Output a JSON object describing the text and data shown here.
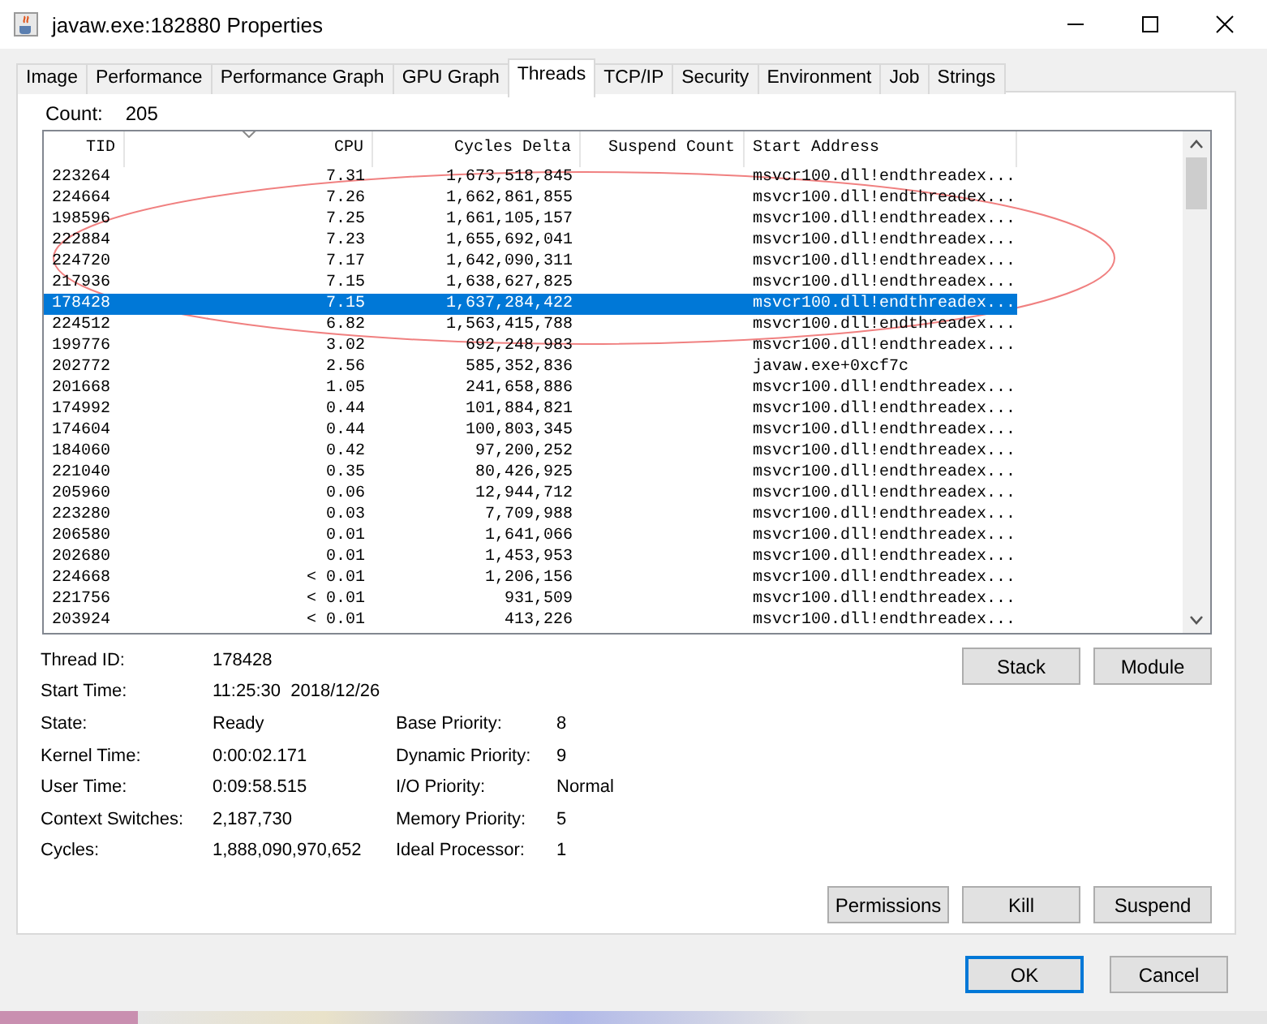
{
  "window": {
    "title": "javaw.exe:182880 Properties"
  },
  "tabs": [
    {
      "label": "Image",
      "selected": false
    },
    {
      "label": "Performance",
      "selected": false
    },
    {
      "label": "Performance Graph",
      "selected": false
    },
    {
      "label": "GPU Graph",
      "selected": false
    },
    {
      "label": "Threads",
      "selected": true
    },
    {
      "label": "TCP/IP",
      "selected": false
    },
    {
      "label": "Security",
      "selected": false
    },
    {
      "label": "Environment",
      "selected": false
    },
    {
      "label": "Job",
      "selected": false
    },
    {
      "label": "Strings",
      "selected": false
    }
  ],
  "count": {
    "label": "Count:",
    "value": "205"
  },
  "table": {
    "columns": [
      "TID",
      "CPU",
      "Cycles Delta",
      "Suspend Count",
      "Start Address"
    ],
    "rows": [
      {
        "tid": "223264",
        "cpu": "7.31",
        "cycles": "1,673,518,845",
        "address": "msvcr100.dll!endthreadex...",
        "selected": false
      },
      {
        "tid": "224664",
        "cpu": "7.26",
        "cycles": "1,662,861,855",
        "address": "msvcr100.dll!endthreadex...",
        "selected": false
      },
      {
        "tid": "198596",
        "cpu": "7.25",
        "cycles": "1,661,105,157",
        "address": "msvcr100.dll!endthreadex...",
        "selected": false
      },
      {
        "tid": "222884",
        "cpu": "7.23",
        "cycles": "1,655,692,041",
        "address": "msvcr100.dll!endthreadex...",
        "selected": false
      },
      {
        "tid": "224720",
        "cpu": "7.17",
        "cycles": "1,642,090,311",
        "address": "msvcr100.dll!endthreadex...",
        "selected": false
      },
      {
        "tid": "217936",
        "cpu": "7.15",
        "cycles": "1,638,627,825",
        "address": "msvcr100.dll!endthreadex...",
        "selected": false
      },
      {
        "tid": "178428",
        "cpu": "7.15",
        "cycles": "1,637,284,422",
        "address": "msvcr100.dll!endthreadex...",
        "selected": true
      },
      {
        "tid": "224512",
        "cpu": "6.82",
        "cycles": "1,563,415,788",
        "address": "msvcr100.dll!endthreadex...",
        "selected": false
      },
      {
        "tid": "199776",
        "cpu": "3.02",
        "cycles": "692,248,983",
        "address": "msvcr100.dll!endthreadex...",
        "selected": false
      },
      {
        "tid": "202772",
        "cpu": "2.56",
        "cycles": "585,352,836",
        "address": "javaw.exe+0xcf7c",
        "selected": false
      },
      {
        "tid": "201668",
        "cpu": "1.05",
        "cycles": "241,658,886",
        "address": "msvcr100.dll!endthreadex...",
        "selected": false
      },
      {
        "tid": "174992",
        "cpu": "0.44",
        "cycles": "101,884,821",
        "address": "msvcr100.dll!endthreadex...",
        "selected": false
      },
      {
        "tid": "174604",
        "cpu": "0.44",
        "cycles": "100,803,345",
        "address": "msvcr100.dll!endthreadex...",
        "selected": false
      },
      {
        "tid": "184060",
        "cpu": "0.42",
        "cycles": "97,200,252",
        "address": "msvcr100.dll!endthreadex...",
        "selected": false
      },
      {
        "tid": "221040",
        "cpu": "0.35",
        "cycles": "80,426,925",
        "address": "msvcr100.dll!endthreadex...",
        "selected": false
      },
      {
        "tid": "205960",
        "cpu": "0.06",
        "cycles": "12,944,712",
        "address": "msvcr100.dll!endthreadex...",
        "selected": false
      },
      {
        "tid": "223280",
        "cpu": "0.03",
        "cycles": "7,709,988",
        "address": "msvcr100.dll!endthreadex...",
        "selected": false
      },
      {
        "tid": "206580",
        "cpu": "0.01",
        "cycles": "1,641,066",
        "address": "msvcr100.dll!endthreadex...",
        "selected": false
      },
      {
        "tid": "202680",
        "cpu": "0.01",
        "cycles": "1,453,953",
        "address": "msvcr100.dll!endthreadex...",
        "selected": false
      },
      {
        "tid": "224668",
        "cpu": "< 0.01",
        "cycles": "1,206,156",
        "address": "msvcr100.dll!endthreadex...",
        "selected": false
      },
      {
        "tid": "221756",
        "cpu": "< 0.01",
        "cycles": "931,509",
        "address": "msvcr100.dll!endthreadex...",
        "selected": false
      },
      {
        "tid": "203924",
        "cpu": "< 0.01",
        "cycles": "413,226",
        "address": "msvcr100.dll!endthreadex...",
        "selected": false
      }
    ]
  },
  "details": {
    "top": [
      {
        "label": "Thread ID:",
        "value": "178428"
      },
      {
        "label": "Start Time:",
        "value": "11:25:30  2018/12/26"
      }
    ],
    "left": [
      {
        "label": "State:",
        "value": "Ready"
      },
      {
        "label": "Kernel Time:",
        "value": "0:00:02.171"
      },
      {
        "label": "User Time:",
        "value": "0:09:58.515"
      },
      {
        "label": "Context Switches:",
        "value": "2,187,730"
      },
      {
        "label": "Cycles:",
        "value": "1,888,090,970,652"
      }
    ],
    "right": [
      {
        "label": "Base Priority:",
        "value": "8"
      },
      {
        "label": "Dynamic Priority:",
        "value": "9"
      },
      {
        "label": "I/O Priority:",
        "value": "Normal"
      },
      {
        "label": "Memory Priority:",
        "value": "5"
      },
      {
        "label": "Ideal Processor:",
        "value": "1"
      }
    ]
  },
  "top_buttons": [
    "Stack",
    "Module"
  ],
  "bottom_buttons": [
    "Permissions",
    "Kill",
    "Suspend"
  ],
  "dialog_buttons": [
    {
      "label": "OK",
      "default": true
    },
    {
      "label": "Cancel",
      "default": false
    }
  ]
}
